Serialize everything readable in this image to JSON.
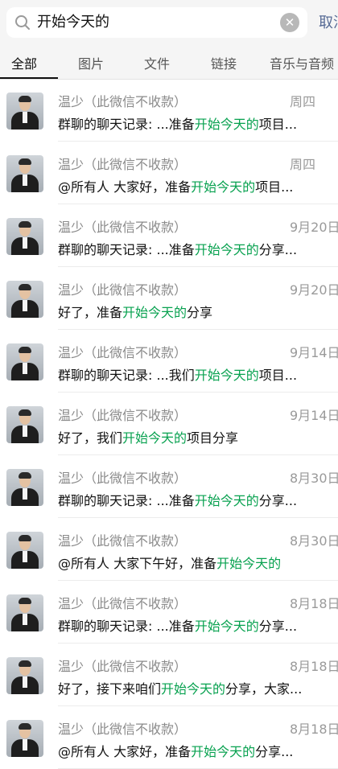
{
  "search": {
    "query": "开始今天的",
    "cancel_label": "取消"
  },
  "tabs": [
    "全部",
    "图片",
    "文件",
    "链接",
    "音乐与音频"
  ],
  "colors": {
    "highlight": "#07a14f",
    "cancel": "#576b95"
  },
  "results": [
    {
      "name": "温少（此微信不收款）",
      "time": "周四",
      "pre": "群聊的聊天记录: ...准备",
      "hit": "开始今天的",
      "post": "项目..."
    },
    {
      "name": "温少（此微信不收款）",
      "time": "周四",
      "pre": "@所有人   大家好，准备",
      "hit": "开始今天的",
      "post": "项目..."
    },
    {
      "name": "温少（此微信不收款）",
      "time": "9月20日",
      "pre": "群聊的聊天记录: ...准备",
      "hit": "开始今天的",
      "post": "分享..."
    },
    {
      "name": "温少（此微信不收款）",
      "time": "9月20日",
      "pre": "好了，准备",
      "hit": "开始今天的",
      "post": "分享"
    },
    {
      "name": "温少（此微信不收款）",
      "time": "9月14日",
      "pre": "群聊的聊天记录: ...我们",
      "hit": "开始今天的",
      "post": "项目..."
    },
    {
      "name": "温少（此微信不收款）",
      "time": "9月14日",
      "pre": "好了，我们",
      "hit": "开始今天的",
      "post": "项目分享"
    },
    {
      "name": "温少（此微信不收款）",
      "time": "8月30日",
      "pre": "群聊的聊天记录: ...准备",
      "hit": "开始今天的",
      "post": "分享..."
    },
    {
      "name": "温少（此微信不收款）",
      "time": "8月30日",
      "pre": "@所有人   大家下午好，准备",
      "hit": "开始今天的",
      "post": ""
    },
    {
      "name": "温少（此微信不收款）",
      "time": "8月18日",
      "pre": "群聊的聊天记录: ...准备",
      "hit": "开始今天的",
      "post": "分享..."
    },
    {
      "name": "温少（此微信不收款）",
      "time": "8月18日",
      "pre": "好了，接下来咱们",
      "hit": "开始今天的",
      "post": "分享，大家..."
    },
    {
      "name": "温少（此微信不收款）",
      "time": "8月18日",
      "pre": "@所有人   大家好，准备",
      "hit": "开始今天的",
      "post": "分享..."
    }
  ]
}
